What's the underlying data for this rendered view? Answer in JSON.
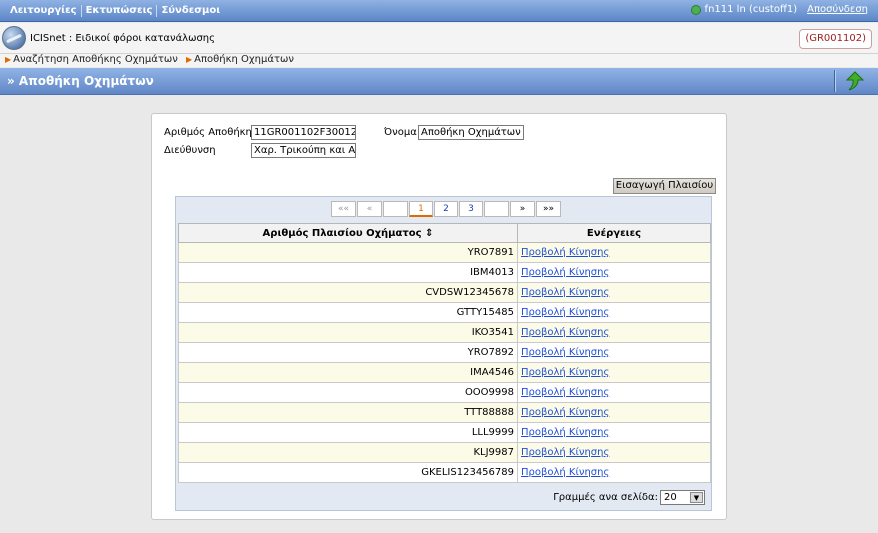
{
  "menu": {
    "items": [
      "Λειτουργίες",
      "Εκτυπώσεις",
      "Σύνδεσμοι"
    ],
    "user_label": "fn111 ln (custoff1)",
    "logout_label": "Αποσύνδεση"
  },
  "header": {
    "app_name": "ICISnet",
    "app_title": " : Ειδικοί φόροι κατανάλωσης",
    "office_badge": "(GR001102)"
  },
  "breadcrumb": [
    "Αναζήτηση Αποθήκης Οχημάτων",
    "Αποθήκη Οχημάτων"
  ],
  "page": {
    "title": "» Αποθήκη Οχημάτων"
  },
  "form": {
    "warehouse_number_label": "Αριθμός Αποθήκης",
    "warehouse_number_value": "11GR001102F30012",
    "name_label": "Όνομα",
    "name_value": "Αποθήκη Οχημάτων Α",
    "address_label": "Διεύθυνση",
    "address_value": "Χαρ. Τρικούπη και Αγ",
    "insert_button": "Εισαγωγή Πλαισίου"
  },
  "pager": {
    "first": "««",
    "prev": "«",
    "pages": [
      "1",
      "2",
      "3"
    ],
    "next": "»",
    "last": "»»"
  },
  "table": {
    "col_chassis": "Αριθμός Πλαισίου Οχήματος ⇕",
    "col_actions": "Ενέργειες",
    "action_label": "Προβολή Κίνησης",
    "rows": [
      "YRO7891",
      "IBM4013",
      "CVDSW12345678",
      "GTTY15485",
      "IKO3541",
      "YRO7892",
      "IMA4546",
      "OOO9998",
      "TTT88888",
      "LLL9999",
      "KLJ9987",
      "GKELIS123456789"
    ]
  },
  "rows_per_page": {
    "label": "Γραμμές ανα σελίδα:",
    "value": "20"
  },
  "colors": {
    "accent": "#6086c6",
    "link": "#1f4fd8",
    "current_page": "#e06a00"
  }
}
